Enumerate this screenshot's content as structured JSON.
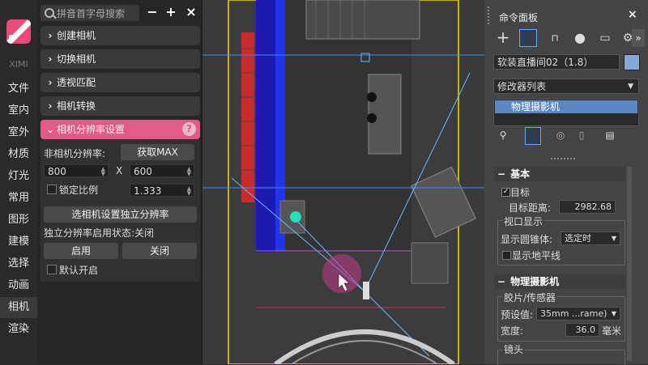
{
  "nav": {
    "brand": "XIMI",
    "items": [
      "文件",
      "室内",
      "室外",
      "材质",
      "灯光",
      "常用",
      "图形",
      "建模",
      "选择",
      "动画",
      "相机",
      "渲染"
    ],
    "active_index": 10
  },
  "panel": {
    "search_placeholder": "拼音首字母搜索",
    "sections": [
      "创建相机",
      "切换相机",
      "透视匹配",
      "相机转换",
      "相机分辨率设置"
    ],
    "res_label": "非相机分辨率:",
    "get_max": "获取MAX",
    "width": "800",
    "times": "X",
    "height": "600",
    "lock_ratio": "锁定比例",
    "ratio": "1.333",
    "set_independent": "选相机设置独立分辨率",
    "status": "独立分辨率启用状态:关闭",
    "enable": "启用",
    "disable": "关闭",
    "default_on": "默认开启"
  },
  "cmd": {
    "title": "命令面板",
    "object_name": "软装直播间02（1.8）",
    "object_color": "#87a7d6",
    "modifier_list": "修改器列表",
    "stack_item": "物理摄影机",
    "basic": {
      "title": "基本",
      "target": "目标",
      "target_dist_label": "目标距离:",
      "target_dist": "2982.68",
      "viewport_group": "视口显示",
      "show_cone_label": "显示圆锥体:",
      "show_cone": "选定时",
      "show_horizon": "显示地平线"
    },
    "physcam": {
      "title": "物理摄影机",
      "film_group": "胶片/传感器",
      "preset_label": "预设值:",
      "preset": "35mm ...rame)",
      "width_label": "宽度:",
      "width": "36.0",
      "unit": "毫米",
      "lens_group": "镜头"
    }
  }
}
